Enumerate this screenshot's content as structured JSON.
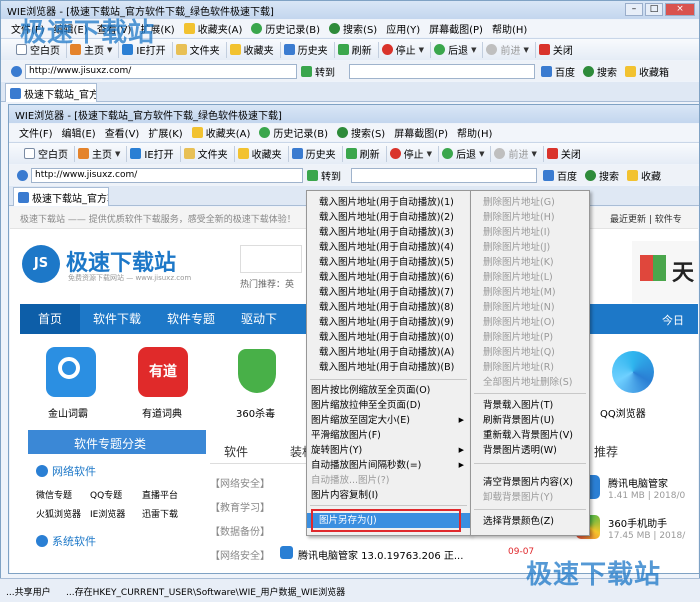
{
  "outer": {
    "title": "WIE浏览器 - [极速下载站_官方软件下载_绿色软件极速下载]",
    "menu": [
      "文件(F)",
      "编辑(E)",
      "查看(V)",
      "扩展(K)",
      "收藏夹(A)",
      "历史记录(B)",
      "搜索(S)",
      "应用(Y)",
      "屏幕截图(P)",
      "帮助(H)"
    ],
    "toolbar": [
      "空白页",
      "主页",
      "IE打开",
      "文件夹",
      "收藏夹",
      "历史夹",
      "刷新",
      "停止",
      "后退",
      "前进",
      "关闭"
    ],
    "address": "http://www.jisuxz.com/",
    "goto_label": "转到",
    "links": [
      "百度",
      "搜索",
      "收藏箱"
    ],
    "tab_label": "极速下载站_官方软"
  },
  "inner": {
    "title": "WIE浏览器 - [极速下载站_官方软件下载_绿色软件极速下载]",
    "menu": [
      "文件(F)",
      "编辑(E)",
      "查看(V)",
      "扩展(K)",
      "收藏夹(A)",
      "历史记录(B)",
      "搜索(S)",
      "屏幕截图(P)",
      "帮助(H)"
    ],
    "toolbar": [
      "空白页",
      "主页",
      "IE打开",
      "文件夹",
      "收藏夹",
      "历史夹",
      "刷新",
      "停止",
      "后退",
      "前进",
      "关闭"
    ],
    "address": "http://www.jisuxz.com/",
    "goto_label": "转到",
    "links": [
      "百度",
      "搜索",
      "收藏"
    ],
    "tab_label": "极速下载站_官方软"
  },
  "site": {
    "topnote": "极速下载站 —— 提供优质软件下载服务，感受全新的极速下载体验！",
    "top_right": "最近更新 | 软件专",
    "logo_text": "极速下载站",
    "logo_sub": "免费资源下载网站 — www.jisuxz.com",
    "hot_label": "热门推荐：英",
    "nav": [
      "首页",
      "软件下载",
      "软件专题",
      "驱动下"
    ],
    "nav_right": "今日",
    "apps": [
      "金山词霸",
      "有道词典",
      "360杀毒"
    ],
    "app_right": "QQ浏览器",
    "topic_title": "软件专题分类",
    "net_title": "网络软件",
    "net_links": [
      "微信专题",
      "QQ专题",
      "直播平台",
      "火狐浏览器",
      "IE浏览器",
      "迅雷下载"
    ],
    "sys_title": "系统软件",
    "col_labels": [
      "软件",
      "装机"
    ],
    "recommend": "推荐",
    "list_tags": [
      "【网络安全】",
      "【教育学习】",
      "【数据备份】",
      "【网络安全】"
    ],
    "list_last_name": "腾讯电脑管家 13.0.19763.206 正...",
    "list_dates": [
      "09-07",
      "09-07"
    ],
    "side_items": [
      {
        "name": "腾讯电脑管家",
        "meta": "1.41 MB | 2018/0"
      },
      {
        "name": "360手机助手",
        "meta": "17.45 MB | 2018/"
      }
    ],
    "ad": "天"
  },
  "context_menu": {
    "left": [
      {
        "label": "载入图片地址(用于自动播放)(1)"
      },
      {
        "label": "载入图片地址(用于自动播放)(2)"
      },
      {
        "label": "载入图片地址(用于自动播放)(3)"
      },
      {
        "label": "载入图片地址(用于自动播放)(4)"
      },
      {
        "label": "载入图片地址(用于自动播放)(5)"
      },
      {
        "label": "载入图片地址(用于自动播放)(6)"
      },
      {
        "label": "载入图片地址(用于自动播放)(7)"
      },
      {
        "label": "载入图片地址(用于自动播放)(8)"
      },
      {
        "label": "载入图片地址(用于自动播放)(9)"
      },
      {
        "label": "载入图片地址(用于自动播放)(0)"
      },
      {
        "label": "载入图片地址(用于自动播放)(A)"
      },
      {
        "label": "载入图片地址(用于自动播放)(B)"
      },
      {
        "label": "图片按比例缩放至全页面(O)"
      },
      {
        "label": "图片缩放拉伸至全页面(D)"
      },
      {
        "label": "图片缩放至固定大小(E)"
      },
      {
        "label": "平滑缩放图片(F)"
      },
      {
        "label": "旋转图片(Y)"
      },
      {
        "label": "自动播放图片间隔秒数(=)"
      },
      {
        "label": "自动播放...图片(?)"
      },
      {
        "label": "图片内容复制(I)"
      },
      {
        "label": "图片另存为(J)"
      }
    ],
    "right": [
      {
        "label": "删除图片地址(G)"
      },
      {
        "label": "删除图片地址(H)"
      },
      {
        "label": "删除图片地址(I)"
      },
      {
        "label": "删除图片地址(J)"
      },
      {
        "label": "删除图片地址(K)"
      },
      {
        "label": "删除图片地址(L)"
      },
      {
        "label": "删除图片地址(M)"
      },
      {
        "label": "删除图片地址(N)"
      },
      {
        "label": "删除图片地址(O)"
      },
      {
        "label": "删除图片地址(P)"
      },
      {
        "label": "删除图片地址(Q)"
      },
      {
        "label": "删除图片地址(R)"
      },
      {
        "label": "全部图片地址删除(S)"
      },
      {
        "label": "背景载入图片(T)"
      },
      {
        "label": "刷新背景图片(U)"
      },
      {
        "label": "重新载入背景图片(V)"
      },
      {
        "label": "背景图片透明(W)"
      },
      {
        "label": "清空背景图片内容(X)"
      },
      {
        "label": "卸载背景图片(Y)"
      },
      {
        "label": "选择背景颜色(Z)"
      }
    ]
  },
  "status": {
    "left": "...共享用户",
    "path": "...存在HKEY_CURRENT_USER\\Software\\WIE_用户数据_WIE浏览器"
  },
  "watermark": "极速下载站",
  "colors": {
    "nav_blue": "#1d78c8",
    "highlight_red": "#e0282c",
    "menu_highlight": "#3b8fe0"
  }
}
